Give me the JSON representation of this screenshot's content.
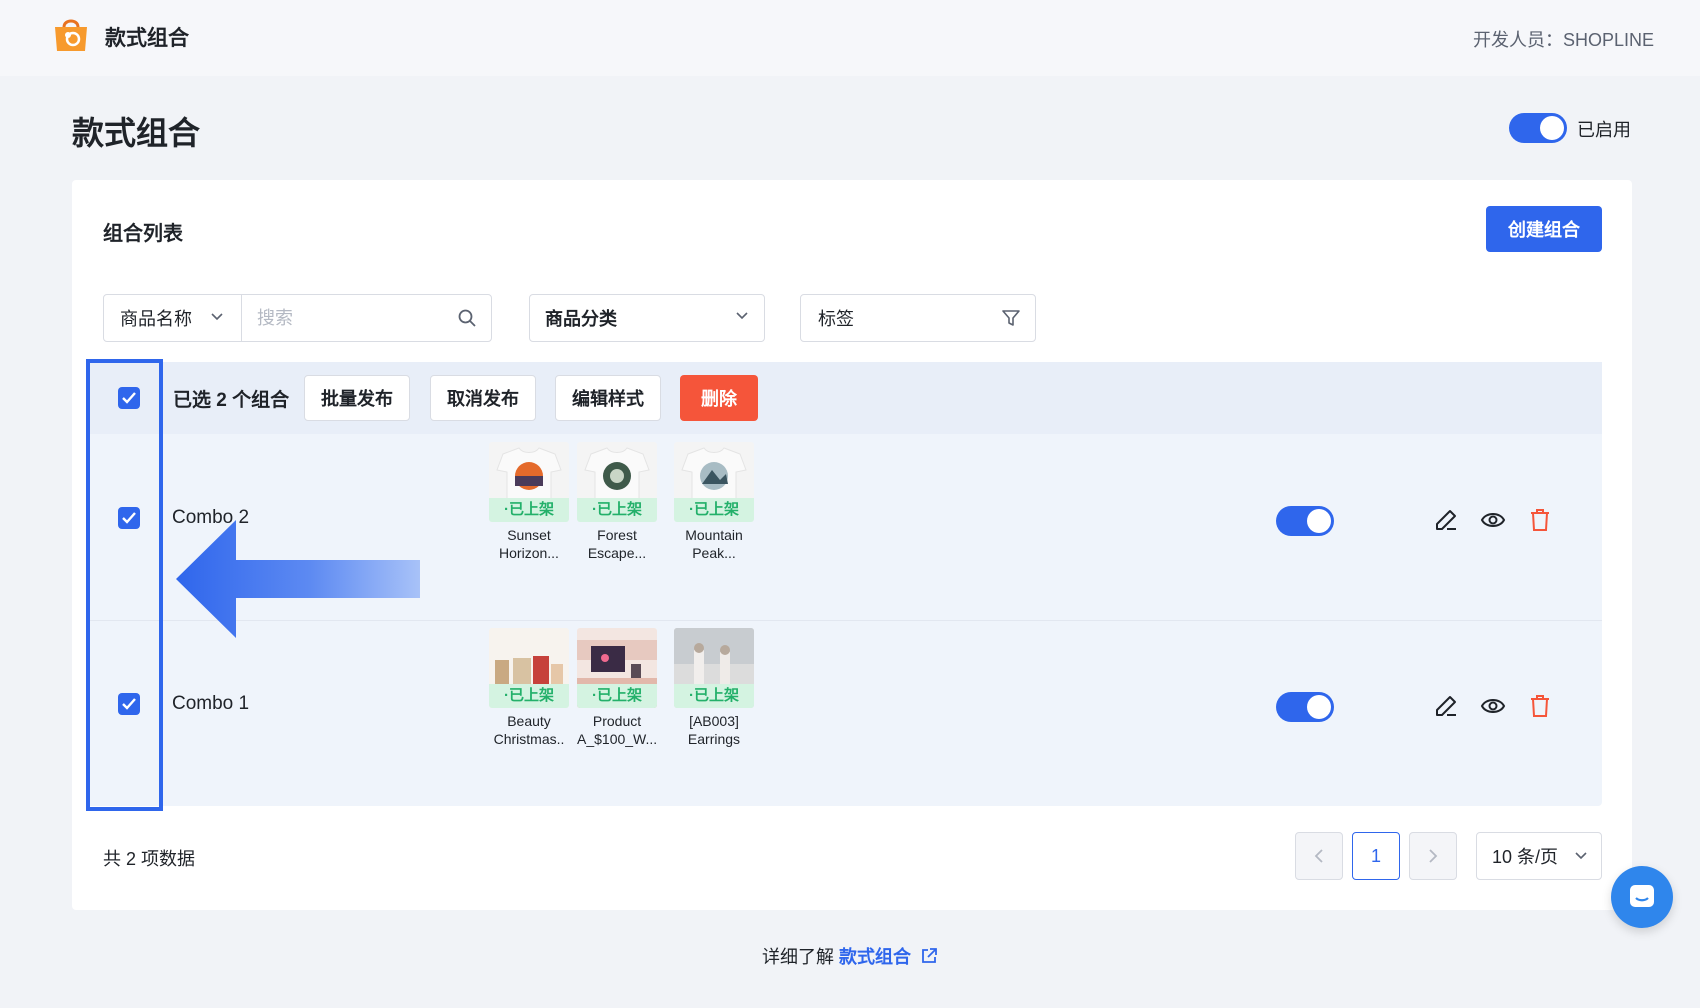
{
  "header": {
    "app_name": "款式组合",
    "developer": "开发人员：SHOPLINE"
  },
  "page": {
    "title": "款式组合",
    "enabled_label": "已启用",
    "enabled": true
  },
  "card": {
    "title": "组合列表",
    "create_button": "创建组合"
  },
  "filters": {
    "search_field": "商品名称",
    "search_placeholder": "搜索",
    "category": "商品分类",
    "tag": "标签"
  },
  "bulk": {
    "selected_label": "已选 2 个组合",
    "publish": "批量发布",
    "unpublish": "取消发布",
    "edit_style": "编辑样式",
    "delete": "删除"
  },
  "rows": [
    {
      "name": "Combo 2",
      "checked": true,
      "published": true,
      "products": [
        {
          "name": "Sunset\nHorizon...",
          "status": "·已上架"
        },
        {
          "name": "Forest\nEscape...",
          "status": "·已上架"
        },
        {
          "name": "Mountain\nPeak...",
          "status": "·已上架"
        }
      ]
    },
    {
      "name": "Combo 1",
      "checked": true,
      "published": true,
      "products": [
        {
          "name": "Beauty\nChristmas..",
          "status": "·已上架"
        },
        {
          "name": "Product\nA_$100_W...",
          "status": "·已上架"
        },
        {
          "name": "[AB003]\nEarrings",
          "status": "·已上架"
        }
      ]
    }
  ],
  "pagination": {
    "total": "共 2 项数据",
    "current_page": "1",
    "page_size": "10 条/页"
  },
  "footer": {
    "text": "详细了解",
    "link": "款式组合"
  },
  "colors": {
    "primary": "#2f66ec",
    "danger": "#f5553a",
    "success": "#23b06a"
  }
}
